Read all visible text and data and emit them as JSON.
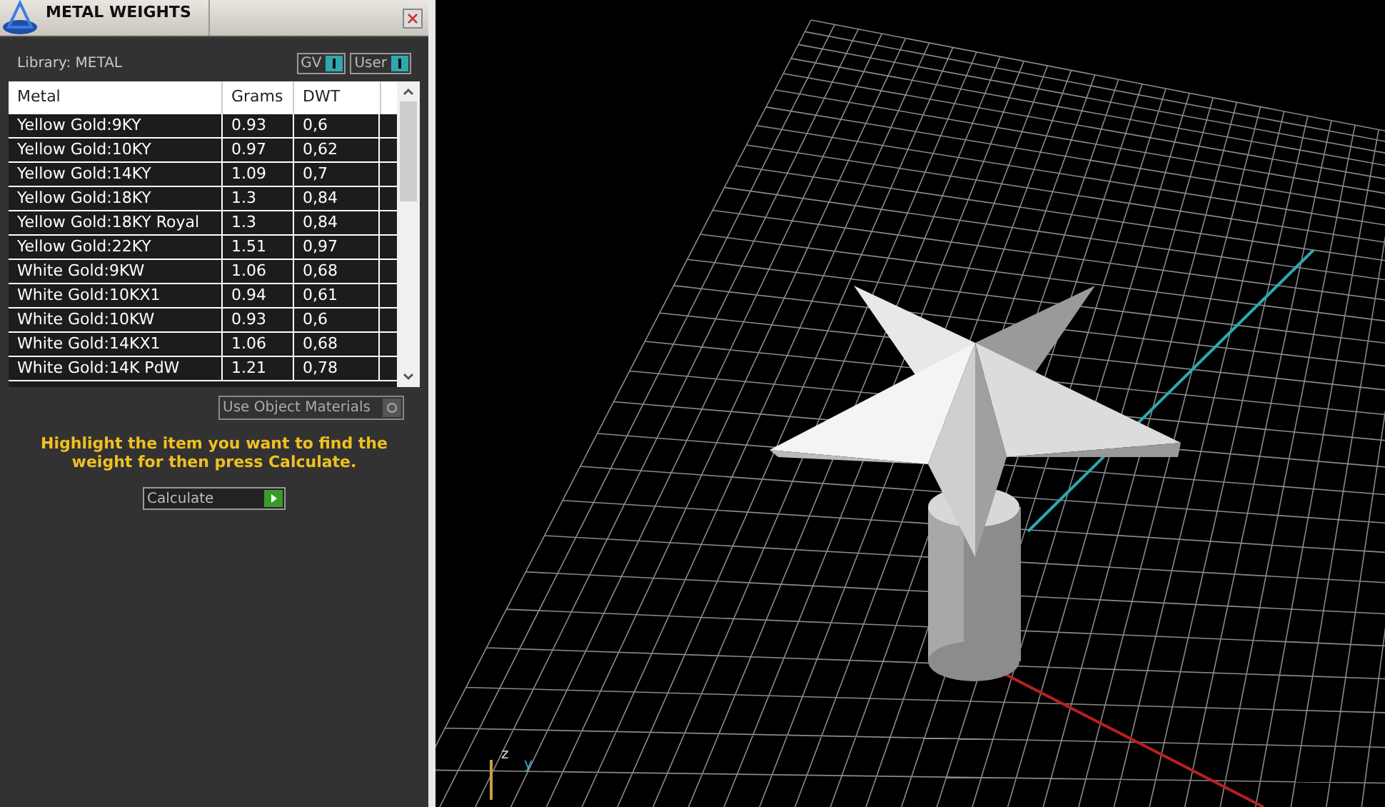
{
  "panel": {
    "title": "METAL WEIGHTS",
    "library": "Library: METAL",
    "toggles": [
      {
        "label": "GV",
        "on": true
      },
      {
        "label": "User",
        "on": true
      }
    ],
    "table": {
      "columns": [
        "Metal",
        "Grams",
        "DWT"
      ],
      "rows": [
        [
          "Yellow Gold:9KY",
          "0.93",
          "0,6"
        ],
        [
          "Yellow Gold:10KY",
          "0.97",
          "0,62"
        ],
        [
          "Yellow Gold:14KY",
          "1.09",
          "0,7"
        ],
        [
          "Yellow Gold:18KY",
          "1.3",
          "0,84"
        ],
        [
          "Yellow Gold:18KY Royal",
          "1.3",
          "0,84"
        ],
        [
          "Yellow Gold:22KY",
          "1.51",
          "0,97"
        ],
        [
          "White Gold:9KW",
          "1.06",
          "0,68"
        ],
        [
          "White Gold:10KX1",
          "0.94",
          "0,61"
        ],
        [
          "White Gold:10KW",
          "0.93",
          "0,6"
        ],
        [
          "White Gold:14KX1",
          "1.06",
          "0,68"
        ],
        [
          "White Gold:14K PdW",
          "1.21",
          "0,78"
        ]
      ]
    },
    "use_object_materials": {
      "label": "Use Object Materials",
      "on": false
    },
    "hint": "Highlight the item you want to find the weight for then press Calculate.",
    "calculate_button": "Calculate"
  },
  "viewport": {
    "axis_labels": [
      "z",
      "y"
    ]
  }
}
